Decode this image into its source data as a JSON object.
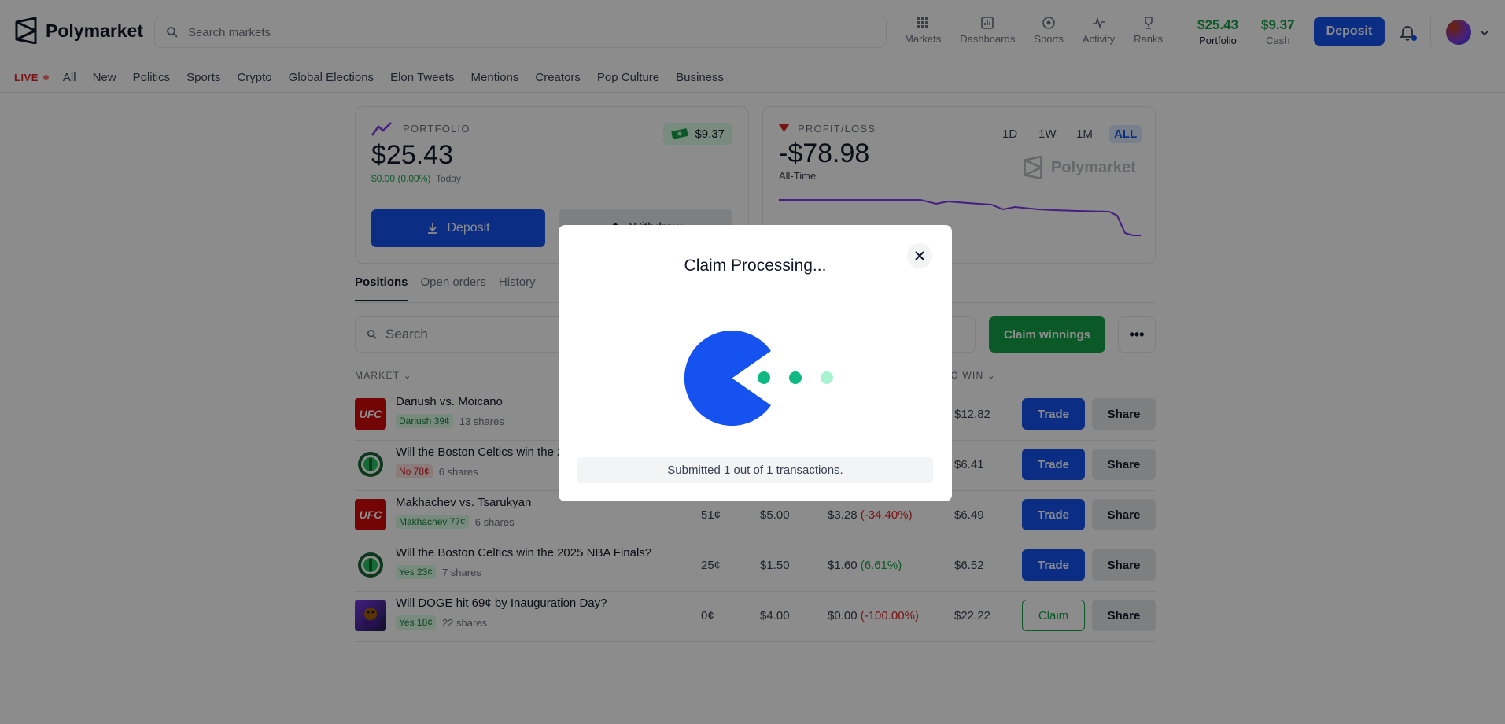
{
  "app": {
    "brand": "Polymarket"
  },
  "header": {
    "search_placeholder": "Search markets",
    "nav": [
      {
        "label": "Markets",
        "icon": "grid-icon"
      },
      {
        "label": "Dashboards",
        "icon": "dashboard-icon"
      },
      {
        "label": "Sports",
        "icon": "sports-icon"
      },
      {
        "label": "Activity",
        "icon": "activity-icon"
      },
      {
        "label": "Ranks",
        "icon": "trophy-icon"
      }
    ],
    "portfolio_value": "$25.43",
    "portfolio_label": "Portfolio",
    "cash_value": "$9.37",
    "cash_label": "Cash",
    "deposit_label": "Deposit"
  },
  "categories": {
    "live": "LIVE",
    "items": [
      "All",
      "New",
      "Politics",
      "Sports",
      "Crypto",
      "Global Elections",
      "Elon Tweets",
      "Mentions",
      "Creators",
      "Pop Culture",
      "Business"
    ]
  },
  "portfolio_card": {
    "label": "PORTFOLIO",
    "value": "$25.43",
    "change": "$0.00 (0.00%)",
    "change_suffix": "Today",
    "cash_pill": "$9.37",
    "deposit_label": "Deposit",
    "withdraw_label": "Withdraw"
  },
  "pl_card": {
    "label": "PROFIT/LOSS",
    "value": "-$78.98",
    "period": "All-Time",
    "timeframes": [
      "1D",
      "1W",
      "1M",
      "ALL"
    ],
    "active_timeframe": "ALL",
    "watermark": "Polymarket"
  },
  "tabs": [
    "Positions",
    "Open orders",
    "History"
  ],
  "positions": {
    "search_placeholder": "Search",
    "claim_winnings_label": "Claim winnings",
    "columns": {
      "market": "MARKET",
      "to_win": "TO WIN"
    },
    "rows": [
      {
        "img": "ufc",
        "title": "Dariush vs. Moicano",
        "tag": "Dariush 39¢",
        "tag_color": "green",
        "shares": "13 shares",
        "avg": "",
        "bet": "",
        "current": "",
        "pct": "",
        "to_win": "$12.82",
        "action": "Trade",
        "share": "Share"
      },
      {
        "img": "celtics",
        "title": "Will the Boston Celtics win the 2025 NBA Finals?",
        "tag": "No 78¢",
        "tag_color": "red",
        "shares": "6 shares",
        "avg": "",
        "bet": "",
        "current": "",
        "pct": "",
        "to_win": "$6.41",
        "action": "Trade",
        "share": "Share"
      },
      {
        "img": "ufc",
        "title": "Makhachev vs. Tsarukyan",
        "tag": "Makhachev 77¢",
        "tag_color": "green",
        "shares": "6 shares",
        "avg": "51¢",
        "bet": "$5.00",
        "current": "$3.28",
        "pct": "(-34.40%)",
        "pct_color": "neg",
        "to_win": "$6.49",
        "action": "Trade",
        "share": "Share"
      },
      {
        "img": "celtics",
        "title": "Will the Boston Celtics win the 2025 NBA Finals?",
        "tag": "Yes 23¢",
        "tag_color": "green",
        "shares": "7 shares",
        "avg": "25¢",
        "bet": "$1.50",
        "current": "$1.60",
        "pct": "(6.61%)",
        "pct_color": "pos",
        "to_win": "$6.52",
        "action": "Trade",
        "share": "Share"
      },
      {
        "img": "doge",
        "title": "Will DOGE hit 69¢ by Inauguration Day?",
        "tag": "Yes 18¢",
        "tag_color": "green",
        "shares": "22 shares",
        "avg": "0¢",
        "bet": "$4.00",
        "current": "$0.00",
        "pct": "(-100.00%)",
        "pct_color": "neg",
        "to_win": "$22.22",
        "action": "Claim",
        "share": "Share"
      }
    ]
  },
  "modal": {
    "title": "Claim Processing...",
    "status": "Submitted 1 out of 1 transactions."
  },
  "colors": {
    "accent": "#1652f0",
    "positive": "#16a34a",
    "negative": "#dc2626"
  }
}
